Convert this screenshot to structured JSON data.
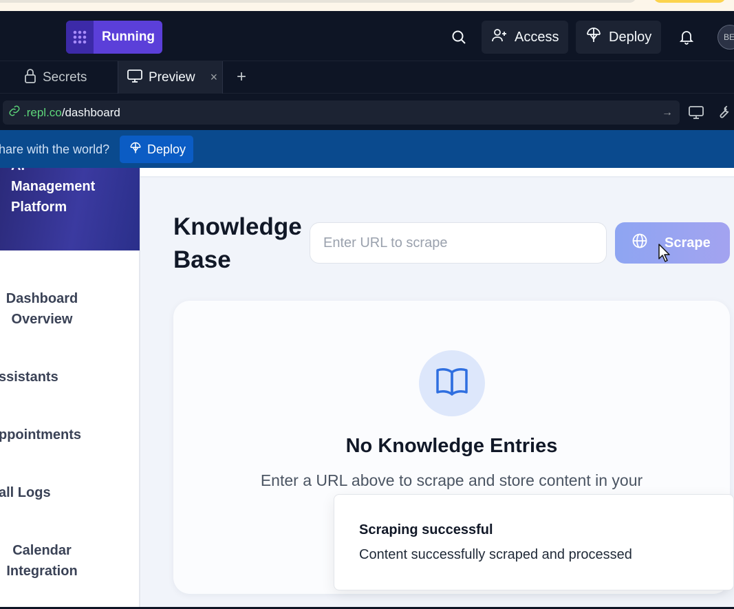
{
  "colors": {
    "header_bg": "#0e1525",
    "run_button": "#5b3fd9",
    "deploy_banner": "#0a4a8e",
    "brand_panel": "#2b2a7a",
    "scrape_button": "#8ea5f2",
    "url_green": "#5dd67a"
  },
  "header": {
    "run_label": "Running",
    "access_label": "Access",
    "deploy_label": "Deploy",
    "avatar_initials": "BE",
    "icons": [
      "replit-logo-icon",
      "search-icon",
      "user-plus-icon",
      "deploy-icon",
      "bell-icon"
    ]
  },
  "tabs": [
    {
      "label": "Secrets",
      "icon": "lock-icon",
      "active": false
    },
    {
      "label": "Preview",
      "icon": "monitor-icon",
      "active": true,
      "close": "×"
    }
  ],
  "tab_add": "+",
  "urlbar": {
    "domain": ".repl.co",
    "path": "/dashboard",
    "go_icon": "→"
  },
  "deploy_banner": {
    "prompt": "hare with the world?",
    "button_label": "Deploy"
  },
  "sidebar": {
    "brand_cut": "AI",
    "brand_name": "Management Platform",
    "items": [
      {
        "label_1": "Dashboard",
        "label_2": "Overview"
      },
      {
        "label_1": "ssistants"
      },
      {
        "label_1": "ppointments"
      },
      {
        "label_1": "all Logs"
      },
      {
        "label_1": "Calendar",
        "label_2": "Integration"
      }
    ]
  },
  "main": {
    "title": "Knowledge Base",
    "url_placeholder": "Enter URL to scrape",
    "scrape_label": "Scrape",
    "empty_title": "No Knowledge Entries",
    "empty_desc": "Enter a URL above to scrape and store content in your"
  },
  "toast": {
    "title": "Scraping successful",
    "message": "Content successfully scraped and processed"
  }
}
